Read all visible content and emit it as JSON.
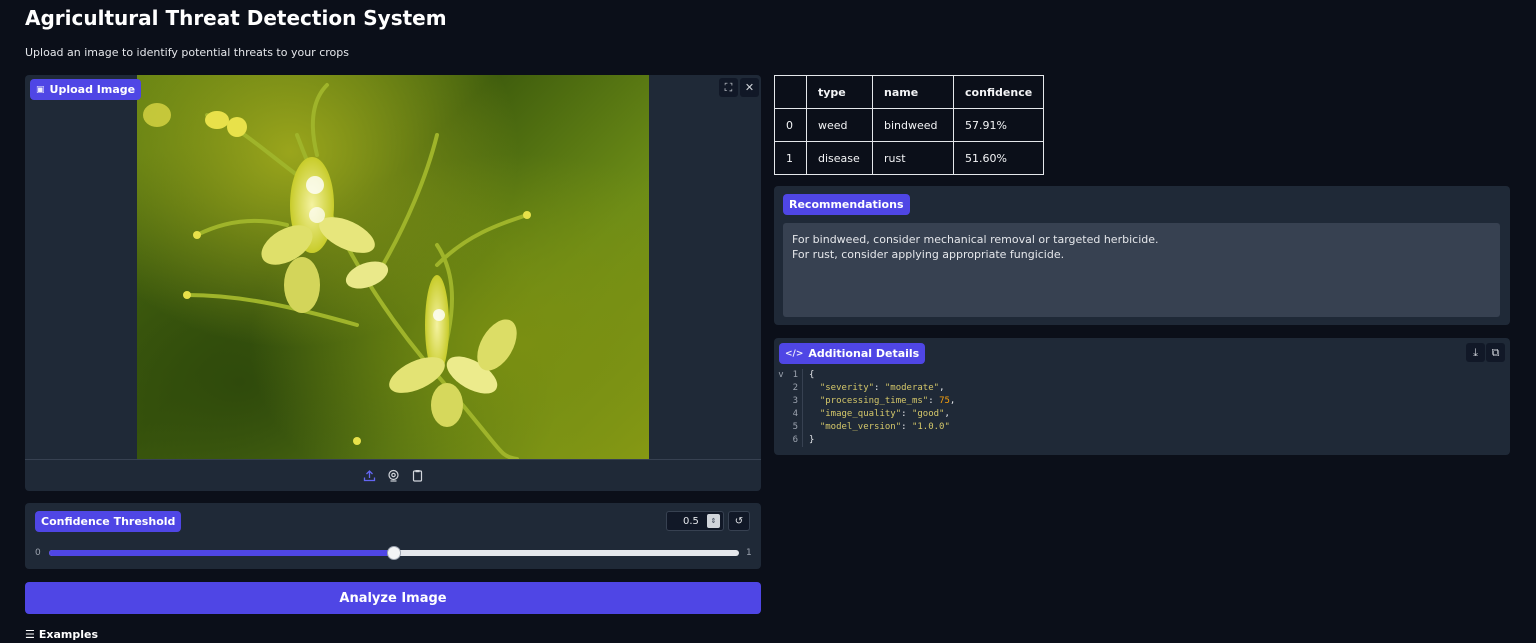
{
  "header": {
    "title": "Agricultural Threat Detection System",
    "subtitle": "Upload an image to identify potential threats to your crops"
  },
  "upload": {
    "label": "Upload Image",
    "label_icon": "image-icon",
    "tools": [
      "fullscreen-icon",
      "close-icon"
    ],
    "sources": [
      "upload-icon",
      "webcam-icon",
      "clipboard-icon"
    ]
  },
  "slider": {
    "label": "Confidence Threshold",
    "value": "0.5",
    "min": "0",
    "max": "1",
    "fraction": 0.5,
    "reset_icon": "reset-icon"
  },
  "analyze_button": "Analyze Image",
  "examples_label": "Examples",
  "results_table": {
    "headers": [
      "",
      "type",
      "name",
      "confidence"
    ],
    "rows": [
      [
        "0",
        "weed",
        "bindweed",
        "57.91%"
      ],
      [
        "1",
        "disease",
        "rust",
        "51.60%"
      ]
    ]
  },
  "recommendations": {
    "label": "Recommendations",
    "lines": [
      "For bindweed, consider mechanical removal or targeted herbicide.",
      "For rust, consider applying appropriate fungicide."
    ]
  },
  "details": {
    "label": "Additional Details",
    "label_icon": "code-icon",
    "tools": [
      "download-icon",
      "copy-icon"
    ],
    "json_lines": [
      {
        "n": "1",
        "fold": "v",
        "parts": [
          {
            "t": "{",
            "c": "br"
          }
        ]
      },
      {
        "n": "2",
        "fold": "",
        "parts": [
          {
            "t": "\"severity\"",
            "c": "str"
          },
          {
            "t": ": ",
            "c": "key"
          },
          {
            "t": "\"moderate\"",
            "c": "str"
          },
          {
            "t": ",",
            "c": "key"
          }
        ]
      },
      {
        "n": "3",
        "fold": "",
        "parts": [
          {
            "t": "\"processing_time_ms\"",
            "c": "str"
          },
          {
            "t": ": ",
            "c": "key"
          },
          {
            "t": "75",
            "c": "num"
          },
          {
            "t": ",",
            "c": "key"
          }
        ]
      },
      {
        "n": "4",
        "fold": "",
        "parts": [
          {
            "t": "\"image_quality\"",
            "c": "str"
          },
          {
            "t": ": ",
            "c": "key"
          },
          {
            "t": "\"good\"",
            "c": "str"
          },
          {
            "t": ",",
            "c": "key"
          }
        ]
      },
      {
        "n": "5",
        "fold": "",
        "parts": [
          {
            "t": "\"model_version\"",
            "c": "str"
          },
          {
            "t": ": ",
            "c": "key"
          },
          {
            "t": "\"1.0.0\"",
            "c": "str"
          }
        ]
      },
      {
        "n": "6",
        "fold": "",
        "parts": [
          {
            "t": "}",
            "c": "br"
          }
        ]
      }
    ]
  }
}
